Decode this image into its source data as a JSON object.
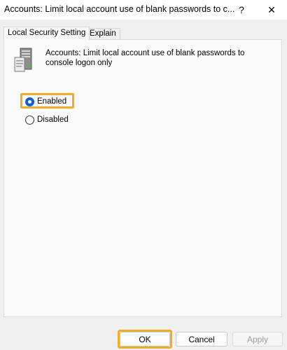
{
  "window": {
    "title": "Accounts: Limit local account use of blank passwords to c...",
    "help_label": "?",
    "close_label": "✕"
  },
  "tabs": [
    {
      "label": "Local Security Setting",
      "active": true
    },
    {
      "label": "Explain",
      "active": false
    }
  ],
  "policy": {
    "icon": "server-policy-icon",
    "description": "Accounts: Limit local account use of blank passwords to console logon only"
  },
  "options": [
    {
      "label": "Enabled",
      "selected": true
    },
    {
      "label": "Disabled",
      "selected": false
    }
  ],
  "buttons": {
    "ok": "OK",
    "cancel": "Cancel",
    "apply": "Apply"
  },
  "colors": {
    "highlight": "#f0ad2a",
    "radio_accent": "#0b5fd6"
  }
}
